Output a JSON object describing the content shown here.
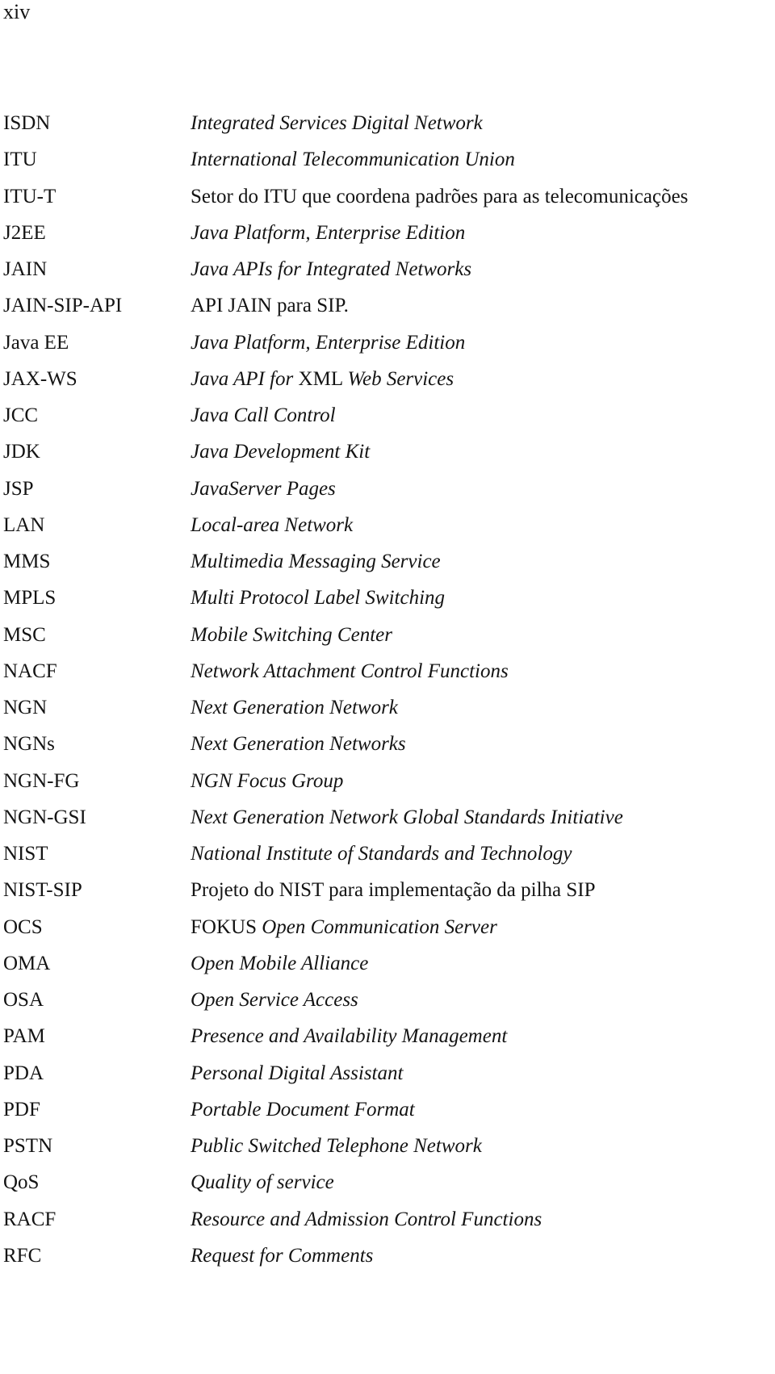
{
  "page": {
    "number": "xiv"
  },
  "abbreviations": [
    {
      "term": "ISDN",
      "definition": [
        {
          "text": "Integrated Services Digital Network",
          "italic": true
        }
      ]
    },
    {
      "term": "ITU",
      "definition": [
        {
          "text": "International Telecommunication Union",
          "italic": true
        }
      ]
    },
    {
      "term": "ITU-T",
      "definition": [
        {
          "text": "Setor do ITU que coordena padrões para as telecomunicações",
          "italic": false
        }
      ]
    },
    {
      "term": "J2EE",
      "definition": [
        {
          "text": "Java Platform, Enterprise Edition",
          "italic": true
        }
      ]
    },
    {
      "term": "JAIN",
      "definition": [
        {
          "text": "Java APIs for Integrated Networks",
          "italic": true
        }
      ]
    },
    {
      "term": "JAIN-SIP-API",
      "definition": [
        {
          "text": "API JAIN para SIP.",
          "italic": false
        }
      ]
    },
    {
      "term": "Java EE",
      "definition": [
        {
          "text": "Java Platform, Enterprise Edition",
          "italic": true
        }
      ]
    },
    {
      "term": "JAX-WS",
      "definition": [
        {
          "text": "Java API for ",
          "italic": true
        },
        {
          "text": "XML ",
          "italic": false
        },
        {
          "text": "Web Services",
          "italic": true
        }
      ]
    },
    {
      "term": "JCC",
      "definition": [
        {
          "text": "Java Call Control",
          "italic": true
        }
      ]
    },
    {
      "term": "JDK",
      "definition": [
        {
          "text": "Java Development Kit",
          "italic": true
        }
      ]
    },
    {
      "term": "JSP",
      "definition": [
        {
          "text": "JavaServer Pages",
          "italic": true
        }
      ]
    },
    {
      "term": "LAN",
      "definition": [
        {
          "text": "Local-area Network",
          "italic": true
        }
      ]
    },
    {
      "term": "MMS",
      "definition": [
        {
          "text": "Multimedia Messaging Service",
          "italic": true
        }
      ]
    },
    {
      "term": "MPLS",
      "definition": [
        {
          "text": "Multi Protocol Label Switching",
          "italic": true
        }
      ]
    },
    {
      "term": "MSC",
      "definition": [
        {
          "text": "Mobile Switching Center",
          "italic": true
        }
      ]
    },
    {
      "term": "NACF",
      "definition": [
        {
          "text": "Network Attachment Control Functions",
          "italic": true
        }
      ]
    },
    {
      "term": "NGN",
      "definition": [
        {
          "text": "Next Generation Network",
          "italic": true
        }
      ]
    },
    {
      "term": "NGNs",
      "definition": [
        {
          "text": "Next Generation Networks",
          "italic": true
        }
      ]
    },
    {
      "term": "NGN-FG",
      "definition": [
        {
          "text": "NGN Focus Group",
          "italic": true
        }
      ]
    },
    {
      "term": "NGN-GSI",
      "definition": [
        {
          "text": "Next Generation Network Global Standards Initiative",
          "italic": true
        }
      ]
    },
    {
      "term": "NIST",
      "definition": [
        {
          "text": "National Institute of Standards and Technology",
          "italic": true
        }
      ]
    },
    {
      "term": "NIST-SIP",
      "definition": [
        {
          "text": "Projeto do NIST para implementação da pilha SIP",
          "italic": false
        }
      ]
    },
    {
      "term": "OCS",
      "definition": [
        {
          "text": "FOKUS ",
          "italic": false
        },
        {
          "text": "Open Communication Server",
          "italic": true
        }
      ]
    },
    {
      "term": "OMA",
      "definition": [
        {
          "text": "Open Mobile Alliance",
          "italic": true
        }
      ]
    },
    {
      "term": "OSA",
      "definition": [
        {
          "text": "Open Service Access",
          "italic": true
        }
      ]
    },
    {
      "term": "PAM",
      "definition": [
        {
          "text": "Presence and Availability Management",
          "italic": true
        }
      ]
    },
    {
      "term": "PDA",
      "definition": [
        {
          "text": "Personal Digital Assistant",
          "italic": true
        }
      ]
    },
    {
      "term": "PDF",
      "definition": [
        {
          "text": "Portable Document Format",
          "italic": true
        }
      ]
    },
    {
      "term": "PSTN",
      "definition": [
        {
          "text": "Public Switched Telephone Network",
          "italic": true
        }
      ]
    },
    {
      "term": "QoS",
      "definition": [
        {
          "text": "Quality of service",
          "italic": true
        }
      ]
    },
    {
      "term": "RACF",
      "definition": [
        {
          "text": "Resource and Admission Control Functions",
          "italic": true
        }
      ]
    },
    {
      "term": "RFC",
      "definition": [
        {
          "text": "Request for Comments",
          "italic": true
        }
      ]
    }
  ]
}
